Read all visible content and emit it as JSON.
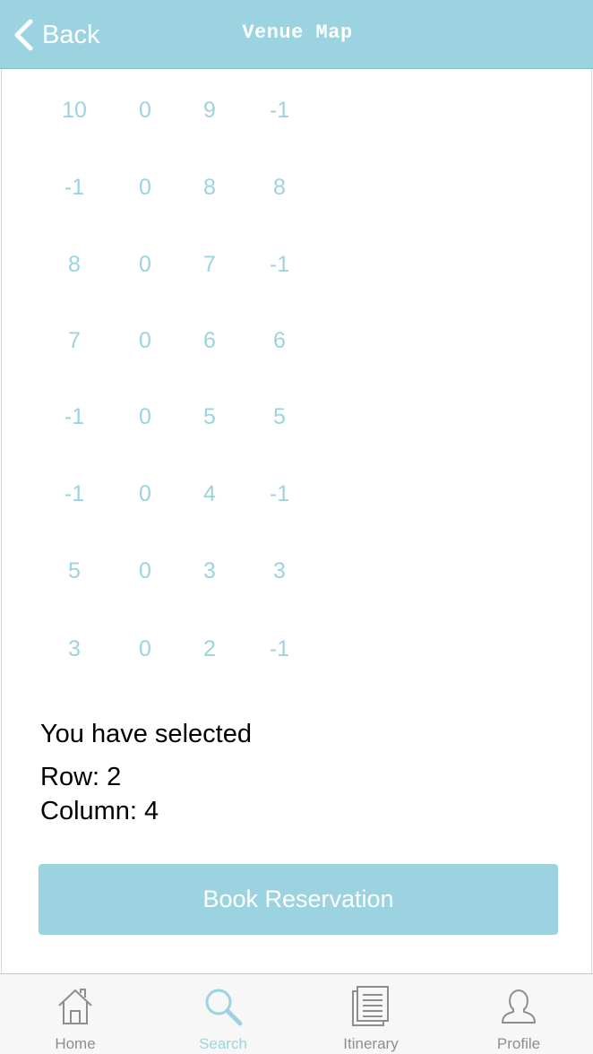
{
  "header": {
    "back_label": "Back",
    "title": "Venue Map"
  },
  "grid": {
    "rows": [
      [
        "10",
        "0",
        "9",
        "-1"
      ],
      [
        "-1",
        "0",
        "8",
        "8"
      ],
      [
        "8",
        "0",
        "7",
        "-1"
      ],
      [
        "7",
        "0",
        "6",
        "6"
      ],
      [
        "-1",
        "0",
        "5",
        "5"
      ],
      [
        "-1",
        "0",
        "4",
        "-1"
      ],
      [
        "5",
        "0",
        "3",
        "3"
      ],
      [
        "3",
        "0",
        "2",
        "-1"
      ]
    ]
  },
  "selection": {
    "heading": "You have selected",
    "row_text": "Row: 2",
    "column_text": "Column: 4"
  },
  "actions": {
    "book_label": "Book Reservation"
  },
  "tabbar": {
    "items": [
      {
        "label": "Home",
        "icon": "home-icon",
        "active": false
      },
      {
        "label": "Search",
        "icon": "search-icon",
        "active": true
      },
      {
        "label": "Itinerary",
        "icon": "itinerary-icon",
        "active": false
      },
      {
        "label": "Profile",
        "icon": "profile-icon",
        "active": false
      }
    ]
  },
  "colors": {
    "accent": "#9bd4e0",
    "inactive_tab": "#8e8e8e"
  }
}
